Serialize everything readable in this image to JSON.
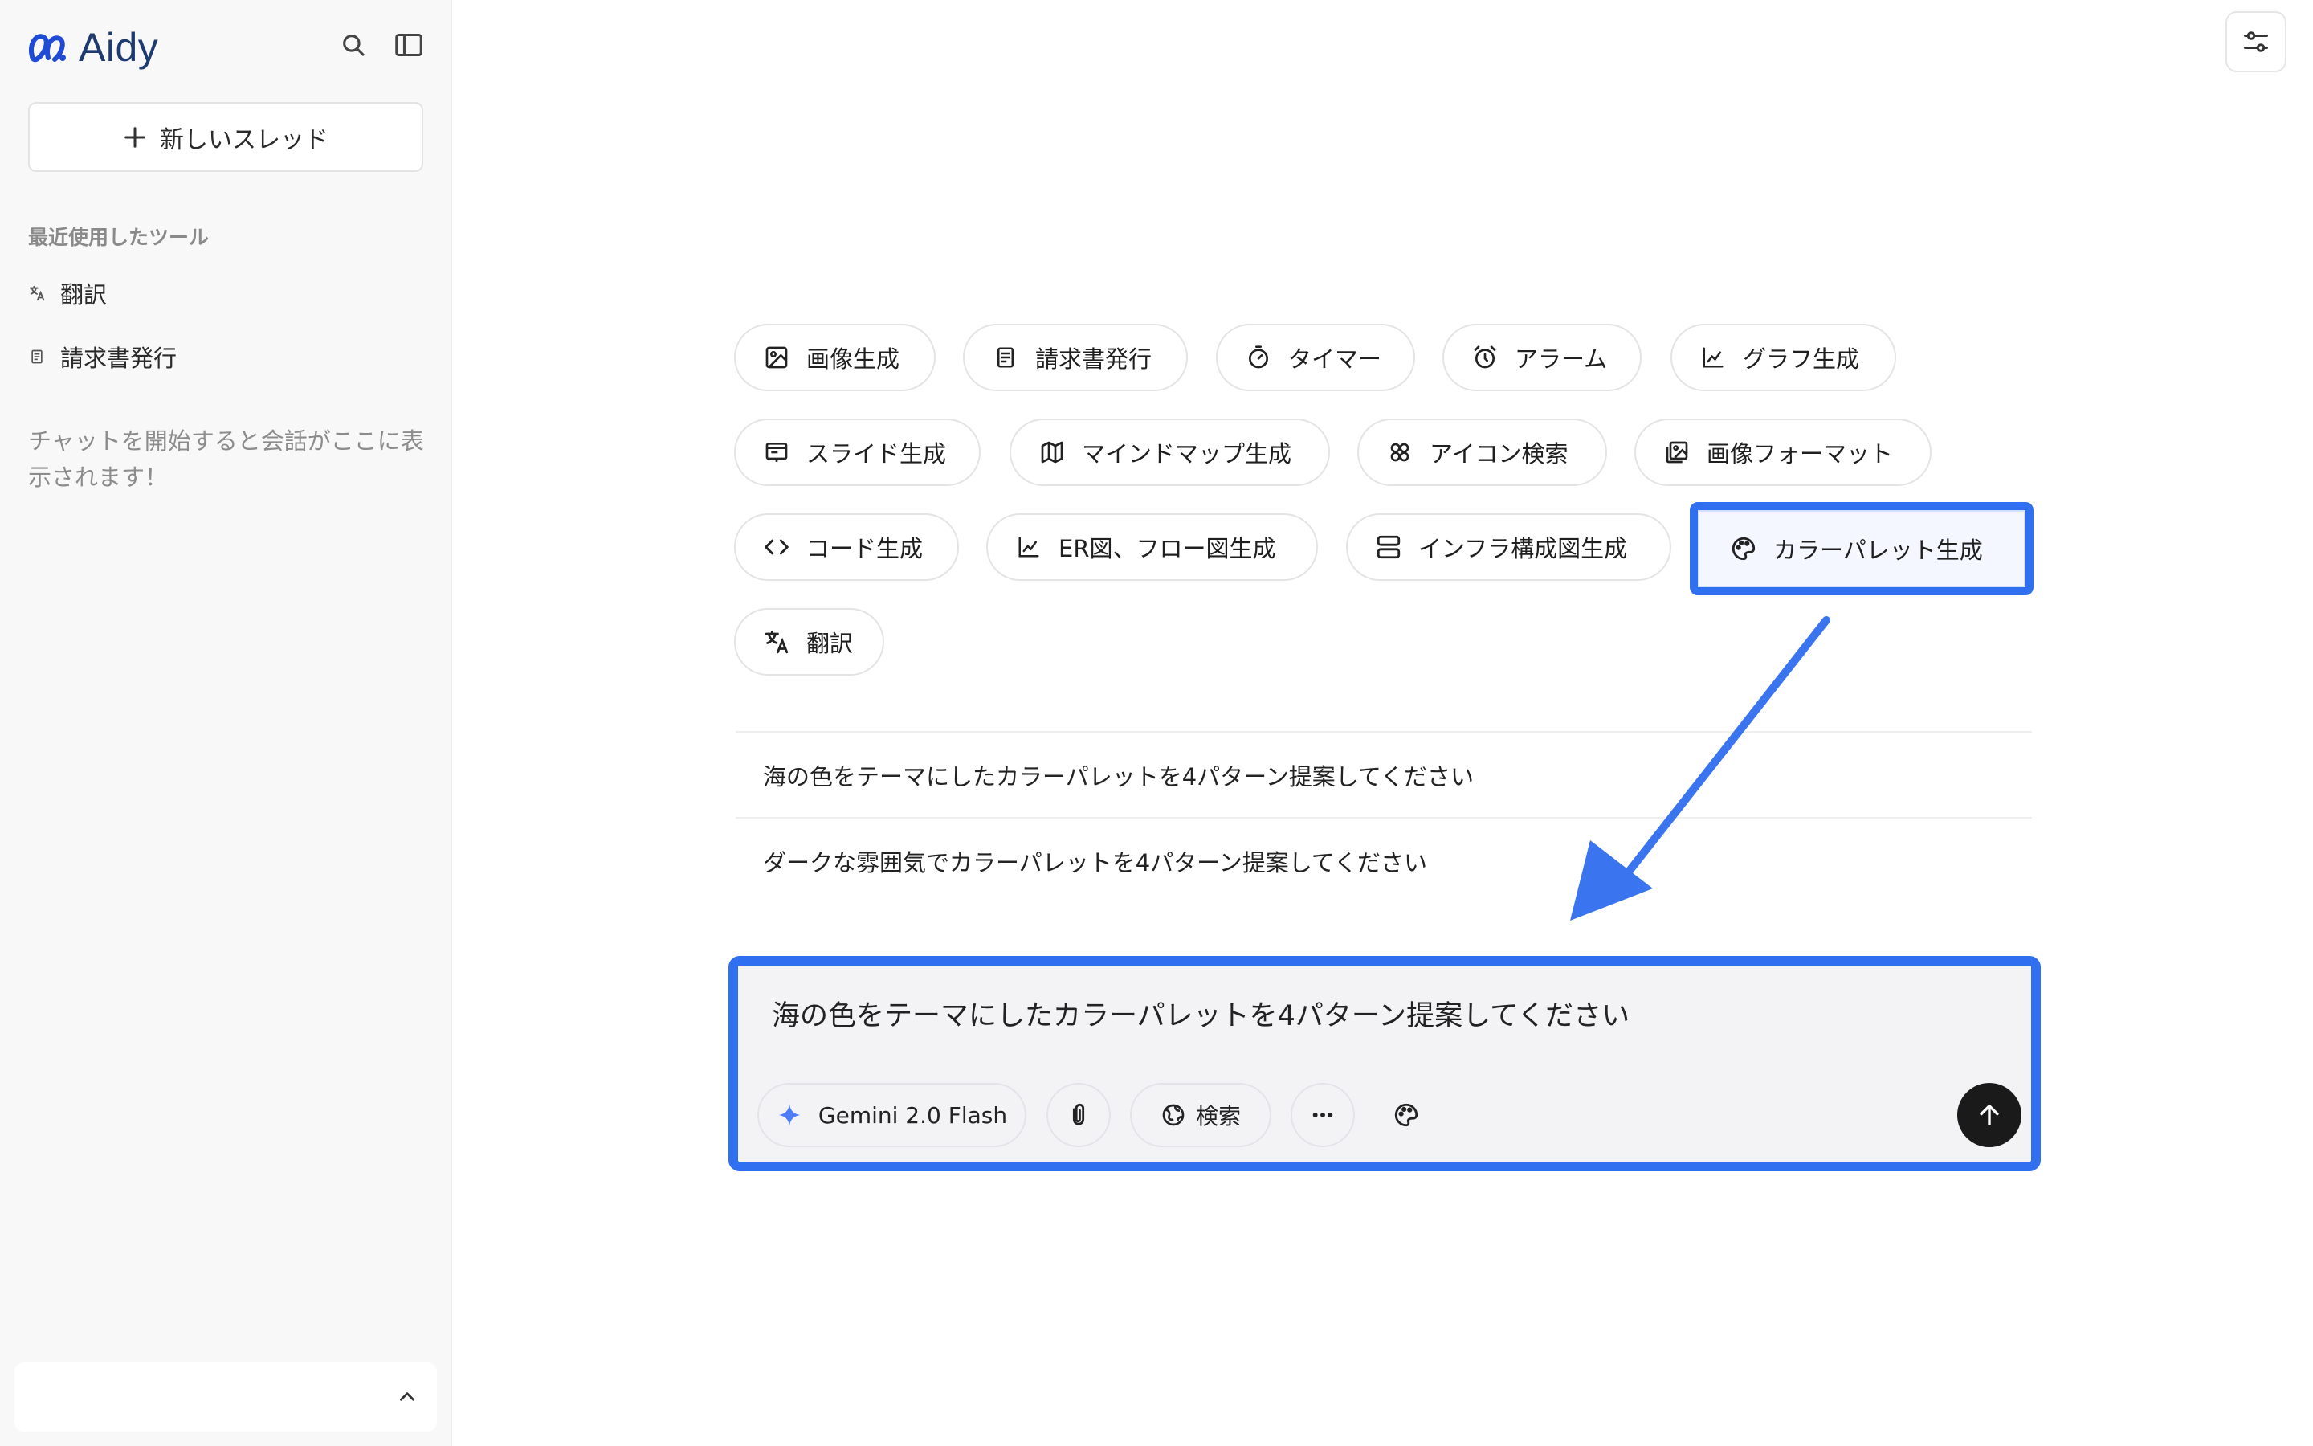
{
  "sidebar": {
    "brand": "Aidy",
    "new_thread_label": "新しいスレッド",
    "recent_section_label": "最近使用したツール",
    "recent_items": [
      {
        "label": "翻訳",
        "icon": "translate-icon"
      },
      {
        "label": "請求書発行",
        "icon": "invoice-icon"
      }
    ],
    "empty_note": "チャットを開始すると会話がここに表示されます！"
  },
  "tools": [
    {
      "label": "画像生成",
      "icon": "image-icon"
    },
    {
      "label": "請求書発行",
      "icon": "invoice-icon"
    },
    {
      "label": "タイマー",
      "icon": "timer-icon"
    },
    {
      "label": "アラーム",
      "icon": "alarm-icon"
    },
    {
      "label": "グラフ生成",
      "icon": "chart-icon"
    },
    {
      "label": "スライド生成",
      "icon": "slide-icon"
    },
    {
      "label": "マインドマップ生成",
      "icon": "map-icon"
    },
    {
      "label": "アイコン検索",
      "icon": "icons-icon"
    },
    {
      "label": "画像フォーマット",
      "icon": "image-format-icon"
    },
    {
      "label": "コード生成",
      "icon": "code-icon"
    },
    {
      "label": "ER図、フロー図生成",
      "icon": "diagram-icon"
    },
    {
      "label": "インフラ構成図生成",
      "icon": "server-icon"
    },
    {
      "label": "カラーパレット生成",
      "icon": "palette-icon",
      "selected": true
    },
    {
      "label": "翻訳",
      "icon": "translate-icon"
    }
  ],
  "suggestions": [
    "海の色をテーマにしたカラーパレットを4パターン提案してください",
    "ダークな雰囲気でカラーパレットを4パターン提案してください"
  ],
  "composer": {
    "text": "海の色をテーマにしたカラーパレットを4パターン提案してください",
    "model_label": "Gemini 2.0 Flash",
    "search_label": "検索"
  },
  "colors": {
    "highlight": "#2f6ff0",
    "brand": "#1e3a6e",
    "send_button": "#1a1a1a"
  }
}
